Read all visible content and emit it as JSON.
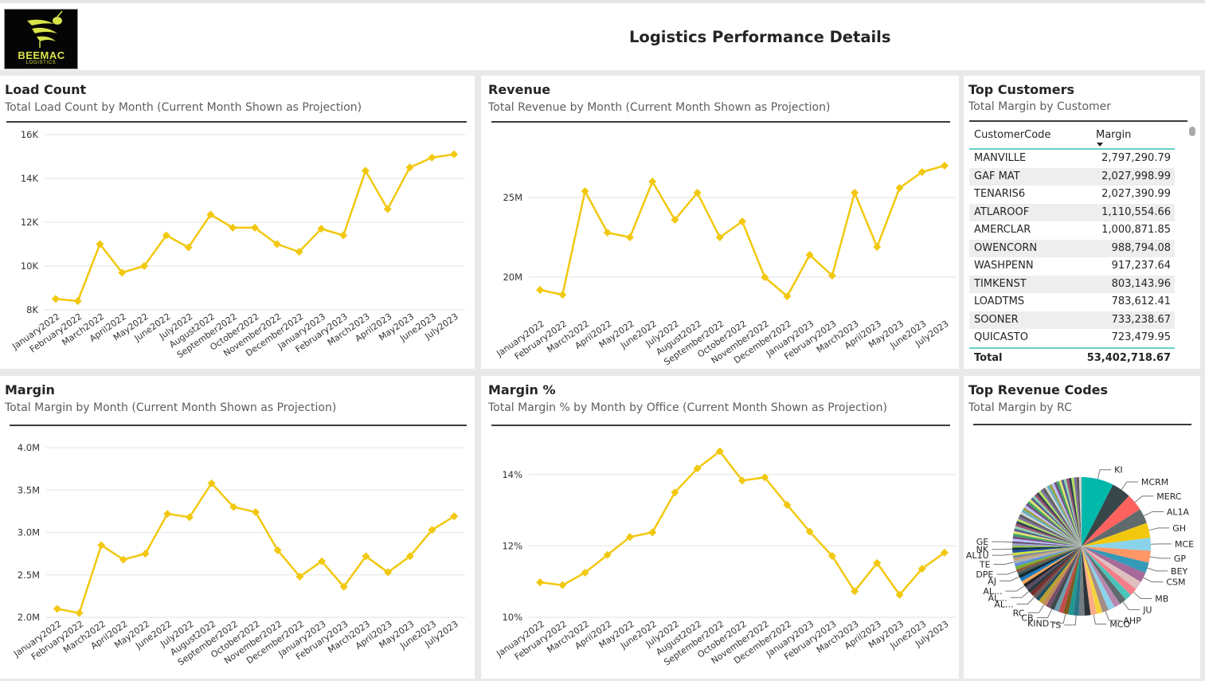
{
  "header": {
    "title": "Logistics Performance Details",
    "logo_brand": "BEEMAC",
    "logo_sub": "LOGISTICS"
  },
  "months": [
    "January2022",
    "February2022",
    "March2022",
    "April2022",
    "May2022",
    "June2022",
    "July2022",
    "August2022",
    "September2022",
    "October2022",
    "November2022",
    "December2022",
    "January2023",
    "February2023",
    "March2023",
    "April2023",
    "May2023",
    "June2023",
    "July2023"
  ],
  "line_color": "#f2c80f",
  "chart_data": [
    {
      "id": "load_count",
      "type": "line",
      "title": "Load Count",
      "subtitle": "Total Load Count by Month (Current Month Shown as Projection)",
      "xlabel": "",
      "ylabel": "",
      "ylim": [
        8000,
        16000
      ],
      "yticks": [
        8000,
        10000,
        12000,
        14000,
        16000
      ],
      "ytick_labels": [
        "8K",
        "10K",
        "12K",
        "14K",
        "16K"
      ],
      "grid": true,
      "values": [
        8500,
        8400,
        11000,
        9700,
        10000,
        11400,
        10850,
        12350,
        11750,
        11750,
        11000,
        10650,
        11700,
        11400,
        14350,
        12600,
        14500,
        14950,
        15100
      ]
    },
    {
      "id": "revenue",
      "type": "line",
      "title": "Revenue",
      "subtitle": "Total Revenue by Month (Current Month Shown as Projection)",
      "xlabel": "",
      "ylabel": "",
      "ylim": [
        17500000,
        28500000
      ],
      "yticks": [
        20000000,
        25000000
      ],
      "ytick_labels": [
        "20M",
        "25M"
      ],
      "grid": true,
      "values": [
        19200000,
        18900000,
        25400000,
        22800000,
        22500000,
        26000000,
        23600000,
        25300000,
        22500000,
        23500000,
        20000000,
        18800000,
        21400000,
        20100000,
        25300000,
        21900000,
        25600000,
        26600000,
        27000000
      ]
    },
    {
      "id": "margin",
      "type": "line",
      "title": "Margin",
      "subtitle": "Total Margin by Month (Current Month Shown as Projection)",
      "xlabel": "",
      "ylabel": "",
      "ylim": [
        2000000,
        4000000
      ],
      "yticks": [
        2000000,
        2500000,
        3000000,
        3500000,
        4000000
      ],
      "ytick_labels": [
        "2.0M",
        "2.5M",
        "3.0M",
        "3.5M",
        "4.0M"
      ],
      "grid": true,
      "values": [
        2100000,
        2050000,
        2850000,
        2680000,
        2750000,
        3220000,
        3180000,
        3580000,
        3300000,
        3240000,
        2790000,
        2480000,
        2660000,
        2360000,
        2720000,
        2530000,
        2720000,
        3030000,
        3190000
      ]
    },
    {
      "id": "margin_pct",
      "type": "line",
      "title": "Margin %",
      "subtitle": "Total Margin % by Month by Office (Current Month Shown as Projection)",
      "xlabel": "",
      "ylabel": "",
      "ylim": [
        10,
        15
      ],
      "yticks": [
        10,
        12,
        14
      ],
      "ytick_labels": [
        "10%",
        "12%",
        "14%"
      ],
      "grid": true,
      "values": [
        10.98,
        10.9,
        11.25,
        11.75,
        12.25,
        12.38,
        13.5,
        14.17,
        14.65,
        13.83,
        13.92,
        13.15,
        12.4,
        11.72,
        10.73,
        11.52,
        10.63,
        11.36,
        11.81
      ]
    },
    {
      "id": "top_revenue_codes",
      "type": "pie",
      "title": "Top Revenue Codes",
      "subtitle": "Total Margin by RC",
      "labeled_slices": [
        {
          "label": "KI",
          "share": 0.075,
          "color": "#01b8aa"
        },
        {
          "label": "MCRM",
          "share": 0.045,
          "color": "#374649"
        },
        {
          "label": "MERC",
          "share": 0.04,
          "color": "#fd625e"
        },
        {
          "label": "AL1A",
          "share": 0.035,
          "color": "#5f6b6d"
        },
        {
          "label": "GH",
          "share": 0.035,
          "color": "#f2c80f"
        },
        {
          "label": "MCE",
          "share": 0.03,
          "color": "#8ad4eb"
        },
        {
          "label": "GP",
          "share": 0.028,
          "color": "#fe9666"
        },
        {
          "label": "BEY",
          "share": 0.025,
          "color": "#3599b8"
        },
        {
          "label": "CSM",
          "share": 0.023,
          "color": "#a66999"
        },
        {
          "label": "",
          "share": 0.02,
          "color": "#dfbfbf"
        },
        {
          "label": "MB",
          "share": 0.018,
          "color": "#f47f8a"
        },
        {
          "label": "",
          "share": 0.016,
          "color": "#4ac5bb"
        },
        {
          "label": "JU",
          "share": 0.016,
          "color": "#5f6b6d"
        },
        {
          "label": "",
          "share": 0.015,
          "color": "#b887ad"
        },
        {
          "label": "",
          "share": 0.015,
          "color": "#8ad4eb"
        },
        {
          "label": "AHP",
          "share": 0.015,
          "color": "#a38d85"
        },
        {
          "label": "",
          "share": 0.014,
          "color": "#f5d33f"
        },
        {
          "label": "MCO",
          "share": 0.014,
          "color": "#fdab89"
        },
        {
          "label": "",
          "share": 0.014,
          "color": "#2a3339"
        },
        {
          "label": "",
          "share": 0.013,
          "color": "#737d80"
        },
        {
          "label": "TS",
          "share": 0.013,
          "color": "#2b7488"
        },
        {
          "label": "",
          "share": 0.012,
          "color": "#1f9a90"
        },
        {
          "label": "KIND",
          "share": 0.012,
          "color": "#7c5a1f"
        },
        {
          "label": "",
          "share": 0.011,
          "color": "#c44b4b"
        },
        {
          "label": "",
          "share": 0.011,
          "color": "#6c9fae"
        },
        {
          "label": "CB",
          "share": 0.011,
          "color": "#3f4a4d"
        },
        {
          "label": "",
          "share": 0.01,
          "color": "#7a4d6b"
        },
        {
          "label": "RC",
          "share": 0.01,
          "color": "#c08a58"
        },
        {
          "label": "",
          "share": 0.01,
          "color": "#b8a12f"
        },
        {
          "label": "",
          "share": 0.009,
          "color": "#1d4f5f"
        },
        {
          "label": "AL...",
          "share": 0.009,
          "color": "#6e5858"
        },
        {
          "label": "",
          "share": 0.009,
          "color": "#7a2c2c"
        },
        {
          "label": "AL...",
          "share": 0.009,
          "color": "#2a3a3a"
        },
        {
          "label": "",
          "share": 0.008,
          "color": "#5b4b6b"
        },
        {
          "label": "AL...",
          "share": 0.008,
          "color": "#222222"
        },
        {
          "label": "",
          "share": 0.008,
          "color": "#f5a55a"
        },
        {
          "label": "",
          "share": 0.008,
          "color": "#1a78c2"
        },
        {
          "label": "AJ",
          "share": 0.008,
          "color": "#0f2a30"
        },
        {
          "label": "",
          "share": 0.007,
          "color": "#4a5a5a"
        },
        {
          "label": "DPE",
          "share": 0.007,
          "color": "#8a5a3a"
        },
        {
          "label": "",
          "share": 0.007,
          "color": "#7ab030"
        },
        {
          "label": "",
          "share": 0.007,
          "color": "#5d8fd8"
        },
        {
          "label": "TE",
          "share": 0.007,
          "color": "#b0b0b0"
        },
        {
          "label": "",
          "share": 0.006,
          "color": "#c8a070"
        },
        {
          "label": "",
          "share": 0.006,
          "color": "#7888a0"
        },
        {
          "label": "AL1U",
          "share": 0.006,
          "color": "#d0e040"
        },
        {
          "label": "",
          "share": 0.006,
          "color": "#2050a0"
        },
        {
          "label": "NK",
          "share": 0.006,
          "color": "#103040"
        },
        {
          "label": "",
          "share": 0.005,
          "color": "#90c050"
        },
        {
          "label": "",
          "share": 0.005,
          "color": "#a0a0d0"
        },
        {
          "label": "GE",
          "share": 0.005,
          "color": "#605070"
        }
      ],
      "remainder_colors": [
        "#c0c0ff",
        "#705080",
        "#40a060",
        "#e0e070",
        "#506090",
        "#90d0b0",
        "#a05070",
        "#304050",
        "#b0e060",
        "#8070a0",
        "#5a5a5a",
        "#d0d0d0",
        "#60b0c0",
        "#a0a040"
      ]
    }
  ],
  "top_customers": {
    "title": "Top Customers",
    "subtitle": "Total Margin by Customer",
    "columns": [
      "CustomerCode",
      "Margin"
    ],
    "rows": [
      [
        "MANVILLE",
        "2,797,290.79"
      ],
      [
        "GAF MAT",
        "2,027,998.99"
      ],
      [
        "TENARIS6",
        "2,027,390.99"
      ],
      [
        "ATLAROOF",
        "1,110,554.66"
      ],
      [
        "AMERCLAR",
        "1,000,871.85"
      ],
      [
        "OWENCORN",
        "988,794.08"
      ],
      [
        "WASHPENN",
        "917,237.64"
      ],
      [
        "TIMKENST",
        "803,143.96"
      ],
      [
        "LOADTMS",
        "783,612.41"
      ],
      [
        "SOONER",
        "733,238.67"
      ],
      [
        "QUICASTO",
        "723,479.95"
      ]
    ],
    "total_label": "Total",
    "total_value": "53,402,718.67"
  }
}
